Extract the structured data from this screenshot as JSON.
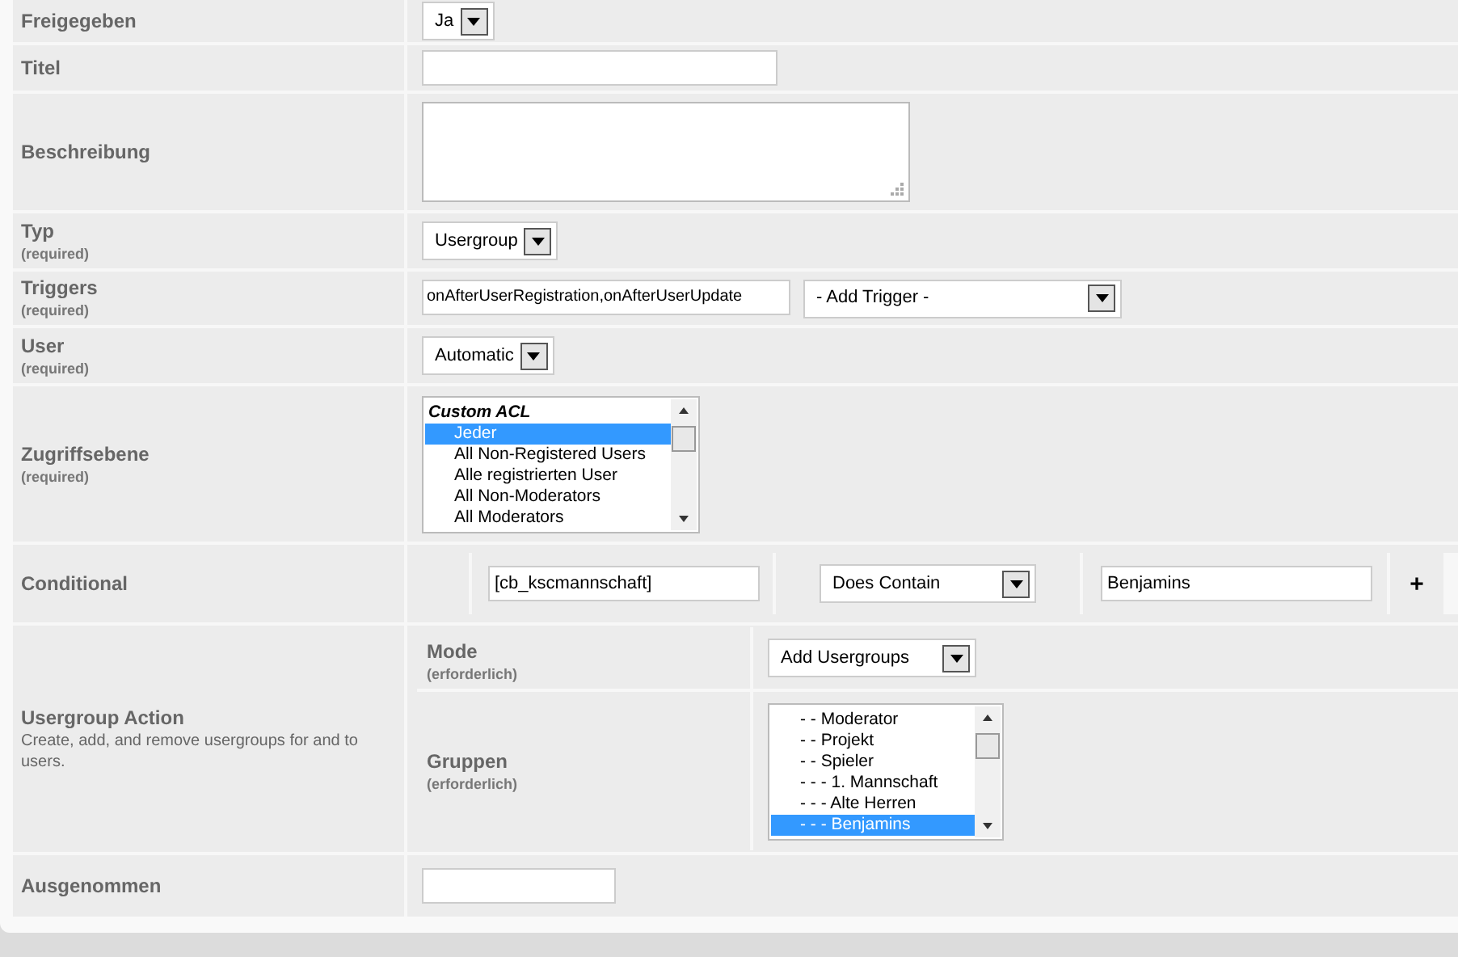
{
  "rows": [
    {
      "kind": "select",
      "label": "Freigegeben",
      "value": "Ja"
    },
    {
      "kind": "text",
      "label": "Titel",
      "value": ""
    },
    {
      "kind": "textarea",
      "label": "Beschreibung"
    },
    {
      "kind": "select",
      "label": "Typ",
      "note": "(required)",
      "value": "Usergroup"
    },
    {
      "kind": "triggers",
      "label": "Triggers",
      "note": "(required)",
      "value": "onAfterUserRegistration,onAfterUserUpdate",
      "select": "- Add Trigger -"
    },
    {
      "kind": "select",
      "label": "User",
      "note": "(required)",
      "value": "Automatic"
    },
    {
      "kind": "listbox",
      "label": "Zugriffsebene",
      "note": "(required)",
      "items": [
        {
          "text": "Custom ACL",
          "header": true,
          "selected": false
        },
        {
          "text": "Jeder",
          "header": false,
          "selected": true
        },
        {
          "text": "All Non-Registered Users",
          "header": false,
          "selected": false
        },
        {
          "text": "Alle registrierten User",
          "header": false,
          "selected": false
        },
        {
          "text": "All Non-Moderators",
          "header": false,
          "selected": false
        },
        {
          "text": "All Moderators",
          "header": false,
          "selected": false
        }
      ]
    },
    {
      "kind": "conditional",
      "label": "Conditional",
      "field": "[cb_kscmannschaft]",
      "operator": "Does Contain",
      "value": "Benjamins",
      "add": "+"
    },
    {
      "kind": "action",
      "label": "Usergroup Action",
      "description": "Create, add, and remove usergroups for and to users.",
      "mode": {
        "label": "Mode",
        "note": "(erforderlich)",
        "value": "Add Usergroups"
      },
      "groups": {
        "label": "Gruppen",
        "note": "(erforderlich)",
        "items": [
          {
            "text": "- - Moderator",
            "header": false,
            "selected": false
          },
          {
            "text": "- - Projekt",
            "header": false,
            "selected": false
          },
          {
            "text": "- - Spieler",
            "header": false,
            "selected": false
          },
          {
            "text": "- - - 1. Mannschaft",
            "header": false,
            "selected": false
          },
          {
            "text": "- - - Alte Herren",
            "header": false,
            "selected": false
          },
          {
            "text": "- - - Benjamins",
            "header": false,
            "selected": true
          }
        ]
      }
    },
    {
      "kind": "text",
      "label": "Ausgenommen",
      "value": ""
    }
  ]
}
